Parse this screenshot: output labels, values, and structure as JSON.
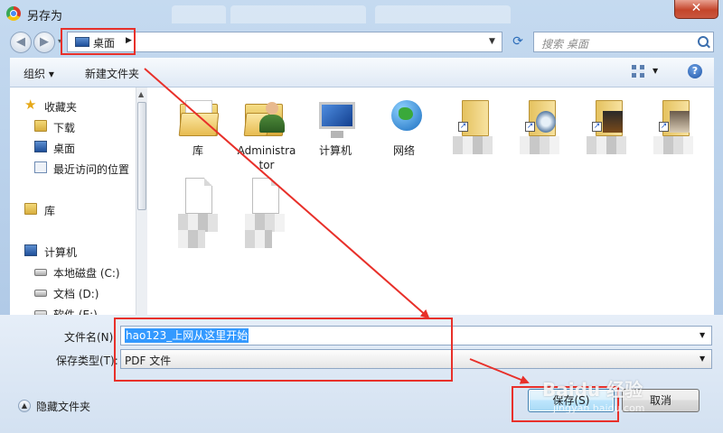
{
  "window": {
    "title": "另存为",
    "close_label": "✕"
  },
  "nav": {
    "back": "◀",
    "forward": "▶",
    "dropdown": "▾",
    "refresh": "⟳"
  },
  "address": {
    "location": "桌面",
    "arrow": "▶",
    "dropdown": "▼"
  },
  "search": {
    "placeholder": "搜索 桌面"
  },
  "toolbar": {
    "organize_label": "组织 ▾",
    "new_folder_label": "新建文件夹",
    "view_dropdown": "▼",
    "help": "?"
  },
  "sidebar": {
    "scroll_up": "▲",
    "items": [
      {
        "label": "收藏夹",
        "icon": "star-icon"
      },
      {
        "label": "下载",
        "icon": "downloads-folder-icon"
      },
      {
        "label": "桌面",
        "icon": "desktop-icon"
      },
      {
        "label": "最近访问的位置",
        "icon": "recent-places-icon"
      },
      {
        "label": "库",
        "icon": "library-icon"
      },
      {
        "label": "计算机",
        "icon": "computer-icon"
      },
      {
        "label": "本地磁盘 (C:)",
        "icon": "drive-icon"
      },
      {
        "label": "文档 (D:)",
        "icon": "drive-icon"
      },
      {
        "label": "软件 (E:)",
        "icon": "drive-icon"
      }
    ]
  },
  "content": {
    "items": [
      {
        "label": "库",
        "icon": "library-folder-icon"
      },
      {
        "label": "Administra\ntor",
        "icon": "user-folder-icon"
      },
      {
        "label": "计算机",
        "icon": "computer-icon"
      },
      {
        "label": "网络",
        "icon": "network-globe-icon"
      }
    ]
  },
  "form": {
    "filename_label": "文件名(N):",
    "filename_value": "hao123_上网从这里开始",
    "filetype_label": "保存类型(T):",
    "filetype_value": "PDF 文件",
    "dropdown": "▼"
  },
  "footer": {
    "hide_folders_label": "隐藏文件夹",
    "hide_icon": "▲",
    "save_label": "保存(S)",
    "cancel_label": "取消"
  },
  "watermark": {
    "text": "Baidu 经验",
    "sub": "jingyan.baidu.com"
  },
  "colors": {
    "annotation_red": "#e8302a",
    "selection_blue": "#3399ff",
    "frame_blue": "#a9c4e3"
  }
}
